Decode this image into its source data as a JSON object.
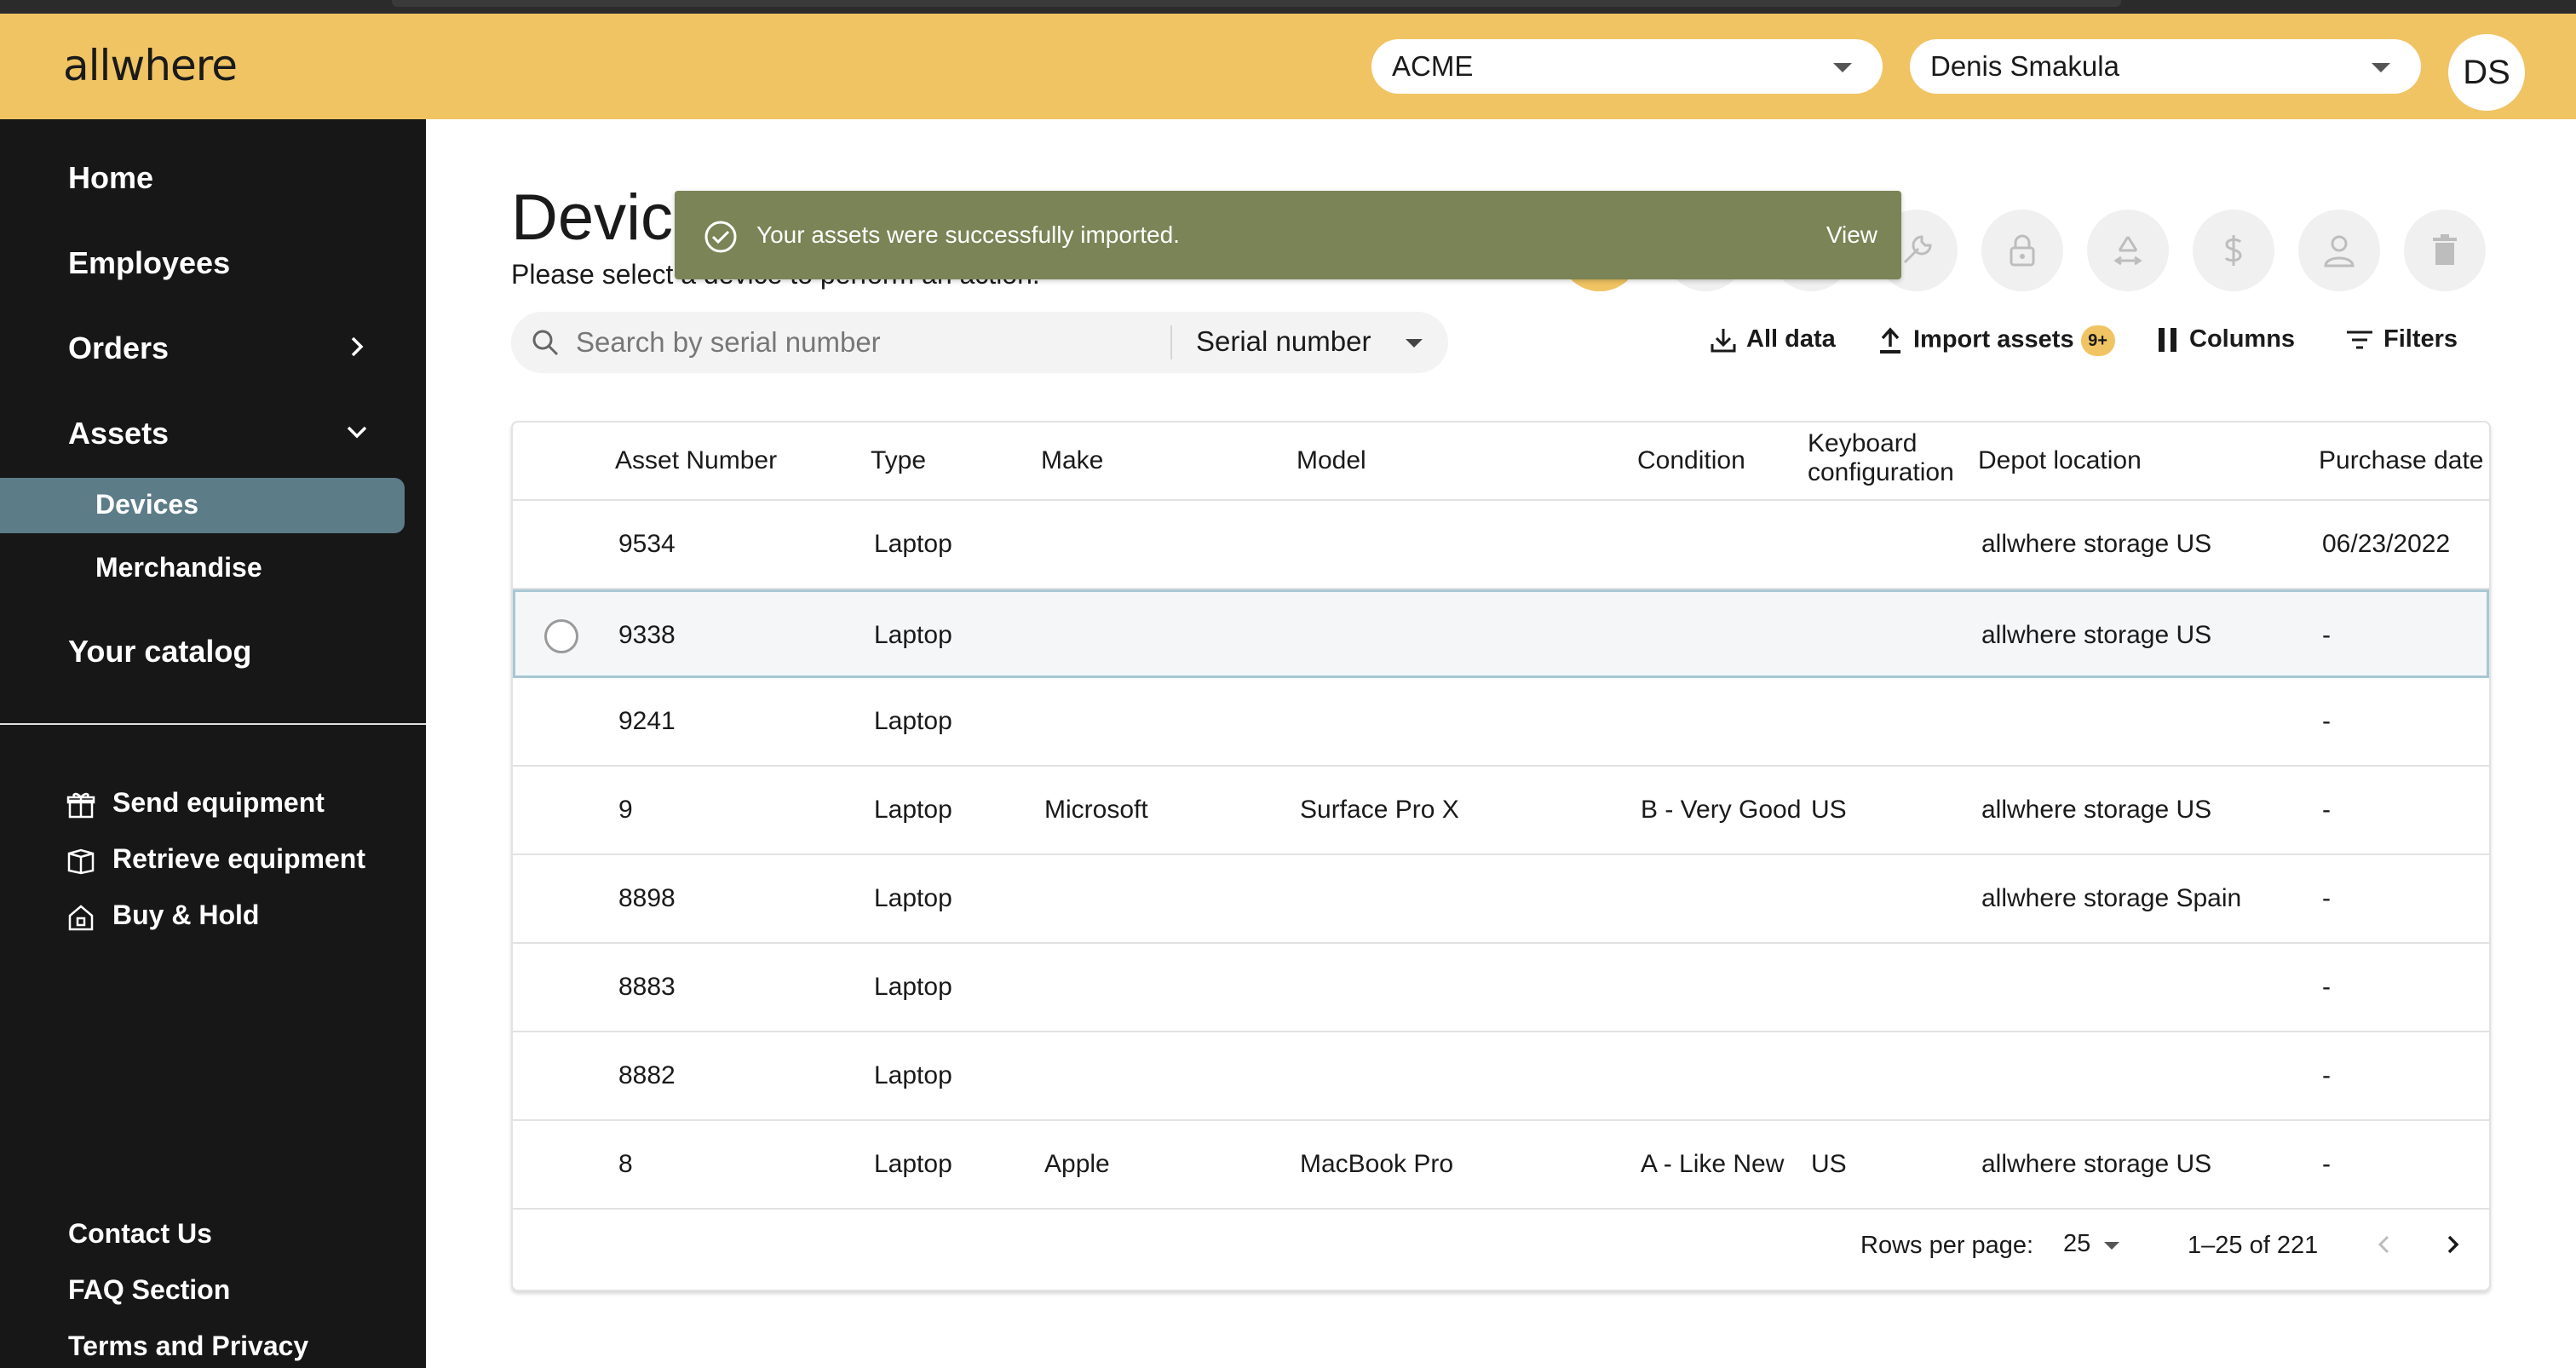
{
  "header": {
    "logo": "allwhere",
    "org_select": "ACME",
    "user_select": "Denis Smakula",
    "avatar_initials": "DS"
  },
  "sidebar": {
    "nav": [
      {
        "label": "Home"
      },
      {
        "label": "Employees"
      },
      {
        "label": "Orders"
      },
      {
        "label": "Assets"
      },
      {
        "label": "Your catalog"
      }
    ],
    "asset_sub": [
      {
        "label": "Devices",
        "active": true
      },
      {
        "label": "Merchandise",
        "active": false
      }
    ],
    "actions": [
      {
        "label": "Send equipment",
        "icon": "gift-icon"
      },
      {
        "label": "Retrieve equipment",
        "icon": "box-icon"
      },
      {
        "label": "Buy & Hold",
        "icon": "house-icon"
      }
    ],
    "footer": [
      {
        "label": "Contact Us"
      },
      {
        "label": "FAQ Section"
      },
      {
        "label": "Terms and Privacy"
      }
    ]
  },
  "page": {
    "title": "Devices",
    "subtitle": "Please select a device to perform an action."
  },
  "toast": {
    "message": "Your assets were successfully imported.",
    "action": "View",
    "color": "#7A8456"
  },
  "search": {
    "placeholder": "Search by serial number",
    "mode": "Serial number"
  },
  "toolbar": {
    "all_data": "All data",
    "import": "Import assets",
    "import_badge": "9+",
    "columns": "Columns",
    "filters": "Filters"
  },
  "table": {
    "columns": [
      "Asset Number",
      "Type",
      "Make",
      "Model",
      "Condition",
      "Keyboard configuration",
      "Depot location",
      "Purchase date"
    ],
    "rows": [
      {
        "asset": "9534",
        "type": "Laptop",
        "make": "",
        "model": "",
        "condition": "",
        "keyboard": "",
        "depot": "allwhere storage US",
        "purchase": "06/23/2022"
      },
      {
        "asset": "9338",
        "type": "Laptop",
        "make": "",
        "model": "",
        "condition": "",
        "keyboard": "",
        "depot": "allwhere storage US",
        "purchase": "-"
      },
      {
        "asset": "9241",
        "type": "Laptop",
        "make": "",
        "model": "",
        "condition": "",
        "keyboard": "",
        "depot": "",
        "purchase": "-"
      },
      {
        "asset": "9",
        "type": "Laptop",
        "make": "Microsoft",
        "model": "Surface Pro X",
        "condition": "B - Very Good",
        "keyboard": "US",
        "depot": "allwhere storage US",
        "purchase": "-"
      },
      {
        "asset": "8898",
        "type": "Laptop",
        "make": "",
        "model": "",
        "condition": "",
        "keyboard": "",
        "depot": "allwhere storage Spain",
        "purchase": "-"
      },
      {
        "asset": "8883",
        "type": "Laptop",
        "make": "",
        "model": "",
        "condition": "",
        "keyboard": "",
        "depot": "",
        "purchase": "-"
      },
      {
        "asset": "8882",
        "type": "Laptop",
        "make": "",
        "model": "",
        "condition": "",
        "keyboard": "",
        "depot": "",
        "purchase": "-"
      },
      {
        "asset": "8",
        "type": "Laptop",
        "make": "Apple",
        "model": "MacBook Pro",
        "condition": "A - Like New",
        "keyboard": "US",
        "depot": "allwhere storage US",
        "purchase": "-"
      }
    ],
    "pagination": {
      "rows_per_page_label": "Rows per page:",
      "rows_per_page": "25",
      "range": "1–25 of 221"
    }
  },
  "colors": {
    "header_bg": "#F0C463",
    "sidebar_bg": "#171717",
    "active_nav": "#5C7C88",
    "selected_row_border": "#A9C7D3"
  }
}
